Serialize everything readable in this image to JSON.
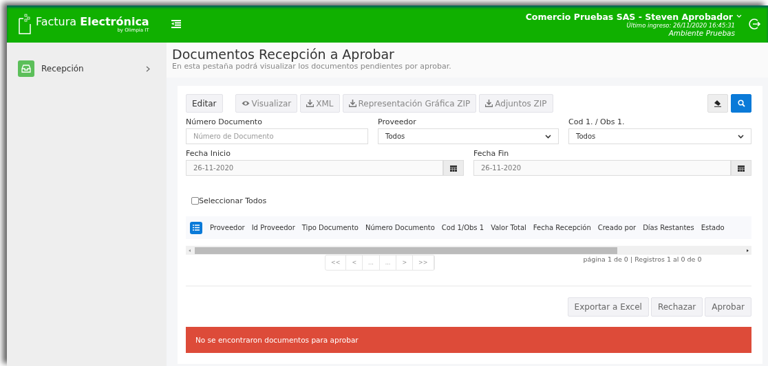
{
  "header": {
    "logo_title": "Factura **Electrónica**",
    "logo_subtitle": "by Olimpia IT",
    "user": "Comercio Pruebas SAS - Steven Aprobador",
    "last_login": "Último ingreso: 26/11/2020 16:45:31",
    "environment": "Ambiente Pruebas"
  },
  "sidebar": {
    "items": [
      {
        "label": "Recepción",
        "selected": false
      }
    ]
  },
  "page": {
    "title": "Documentos Recepción a Aprobar",
    "subtitle": "En esta pestaña podrá visualizar los documentos pendientes por aprobar."
  },
  "toolbar": {
    "buttons": [
      {
        "label": "Editar",
        "disabled": false
      },
      {
        "label": "Visualizar",
        "disabled": true
      },
      {
        "label": "XML",
        "disabled": true
      },
      {
        "label": "Representación Gráfica ZIP",
        "disabled": true
      },
      {
        "label": "Adjuntos ZIP",
        "disabled": true
      }
    ]
  },
  "filters": [
    {
      "label": "Número Documento",
      "kind": "text",
      "placeholder": "Número de Documento"
    },
    {
      "label": "Proveedor",
      "kind": "select",
      "value": "Todos"
    },
    {
      "label": "Cod 1. / Obs 1.",
      "kind": "select",
      "value": "Todos"
    },
    {
      "label": "Fecha Inicio",
      "kind": "date",
      "value": "26-11-2020"
    },
    {
      "label": "Fecha Fin",
      "kind": "date",
      "value": "26-11-2020"
    }
  ],
  "select_all": {
    "label": "Seleccionar Todos",
    "checked": false
  },
  "table": {
    "columns": [
      "Proveedor",
      "Id Proveedor",
      "Tipo Documento",
      "Número Documento",
      "Cod 1/Obs 1",
      "Valor Total",
      "Fecha Recepción",
      "Creado por",
      "Días Restantes",
      "Estado"
    ]
  },
  "pagination": {
    "buttons": [
      "<<",
      "<",
      "...",
      "...",
      ">",
      ">>"
    ],
    "info": "página 1 de 0 | Registros 1 al 0 de 0"
  },
  "actions": [
    "Exportar a Excel",
    "Rechazar",
    "Aprobar"
  ],
  "alert": {
    "text": "No se encontraron documentos para aprobar"
  }
}
